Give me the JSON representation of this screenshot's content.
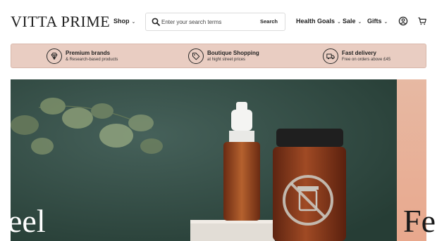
{
  "brand": {
    "logo_text": "VITTA PRIME"
  },
  "nav": {
    "shop": "Shop",
    "health_goals": "Health Goals",
    "sale": "Sale",
    "gifts": "Gifts"
  },
  "search": {
    "placeholder": "Enter your search terms",
    "button_label": "Search"
  },
  "icons": {
    "account": "user-circle-icon",
    "cart": "cart-icon",
    "search": "search-icon",
    "chevron": "chevron-down-icon"
  },
  "benefits": [
    {
      "title": "Premium brands",
      "subtitle": "& Research-based products",
      "icon": "diamond-icon"
    },
    {
      "title": "Boutique Shopping",
      "subtitle": "at hight street prices",
      "icon": "tag-icon"
    },
    {
      "title": "Fast delivery",
      "subtitle": "Free on orders above £45",
      "icon": "truck-icon"
    }
  ],
  "hero": {
    "left_text": "eel",
    "right_text": "Fe"
  },
  "colors": {
    "benefits_bg": "#e9cdc2",
    "hero_green": "#2f4a41",
    "hero_peach": "#e8a88d",
    "bottle_amber": "#8a3a1c"
  }
}
